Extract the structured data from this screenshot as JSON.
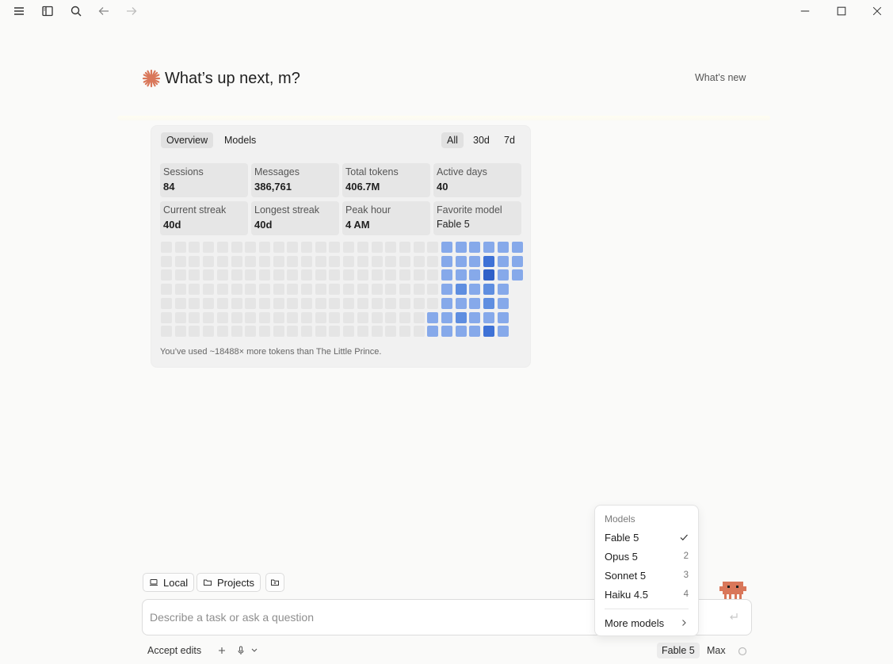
{
  "header": {
    "title": "What’s up next, m?",
    "whats_new": "What’s new"
  },
  "stats": {
    "tabs": [
      "Overview",
      "Models"
    ],
    "ranges": [
      "All",
      "30d",
      "7d"
    ],
    "items": [
      {
        "label": "Sessions",
        "value": "84"
      },
      {
        "label": "Messages",
        "value": "386,761"
      },
      {
        "label": "Total tokens",
        "value": "406.7M"
      },
      {
        "label": "Active days",
        "value": "40"
      },
      {
        "label": "Current streak",
        "value": "40d"
      },
      {
        "label": "Longest streak",
        "value": "40d"
      },
      {
        "label": "Peak hour",
        "value": "4 AM"
      },
      {
        "label": "Favorite model",
        "value": "Fable 5"
      }
    ],
    "heatmap": {
      "columns": 26,
      "rows": 7,
      "levels": [
        [
          0,
          0,
          0,
          0,
          0,
          0,
          0,
          0,
          0,
          0,
          0,
          0,
          0,
          0,
          0,
          0,
          0,
          0,
          0,
          0,
          2,
          2,
          2,
          2,
          2,
          2
        ],
        [
          0,
          0,
          0,
          0,
          0,
          0,
          0,
          0,
          0,
          0,
          0,
          0,
          0,
          0,
          0,
          0,
          0,
          0,
          0,
          0,
          2,
          2,
          2,
          4,
          2,
          2
        ],
        [
          0,
          0,
          0,
          0,
          0,
          0,
          0,
          0,
          0,
          0,
          0,
          0,
          0,
          0,
          0,
          0,
          0,
          0,
          0,
          0,
          2,
          2,
          2,
          5,
          2,
          2
        ],
        [
          0,
          0,
          0,
          0,
          0,
          0,
          0,
          0,
          0,
          0,
          0,
          0,
          0,
          0,
          0,
          0,
          0,
          0,
          0,
          0,
          2,
          3,
          2,
          3,
          2,
          -1
        ],
        [
          0,
          0,
          0,
          0,
          0,
          0,
          0,
          0,
          0,
          0,
          0,
          0,
          0,
          0,
          0,
          0,
          0,
          0,
          0,
          0,
          2,
          2,
          2,
          3,
          2,
          -1
        ],
        [
          0,
          0,
          0,
          0,
          0,
          0,
          0,
          0,
          0,
          0,
          0,
          0,
          0,
          0,
          0,
          0,
          0,
          0,
          0,
          2,
          2,
          3,
          2,
          2,
          2,
          -1
        ],
        [
          0,
          0,
          0,
          0,
          0,
          0,
          0,
          0,
          0,
          0,
          0,
          0,
          0,
          0,
          0,
          0,
          0,
          0,
          0,
          2,
          2,
          2,
          2,
          4,
          2,
          -1
        ]
      ],
      "colors": {
        "0": "#e5e5e5",
        "2": "#86a9ea",
        "3": "#5f8ee0",
        "4": "#3f72d6",
        "5": "#2f60c8"
      }
    },
    "note": "You’ve used ~18488× more tokens than The Little Prince."
  },
  "chips": {
    "local": "Local",
    "projects": "Projects"
  },
  "input": {
    "placeholder": "Describe a task or ask a question"
  },
  "toolbar": {
    "accept_edits": "Accept edits",
    "model": "Fable 5",
    "effort": "Max"
  },
  "dropdown": {
    "heading": "Models",
    "items": [
      {
        "label": "Fable 5",
        "key": "",
        "selected": true
      },
      {
        "label": "Opus 5",
        "key": "2"
      },
      {
        "label": "Sonnet 5",
        "key": "3"
      },
      {
        "label": "Haiku 4.5",
        "key": "4"
      }
    ],
    "more": "More models"
  },
  "colors": {
    "accent": "#d9775a",
    "mascot": "#d9775a"
  }
}
